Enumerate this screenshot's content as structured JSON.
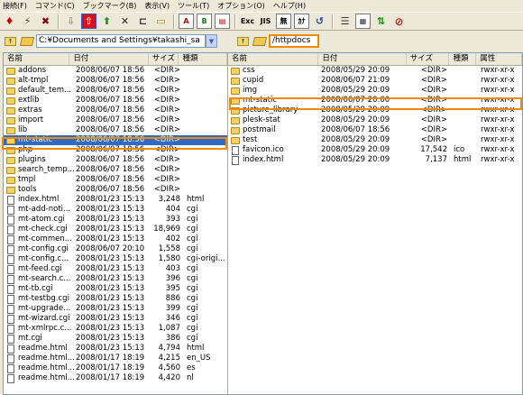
{
  "menu": [
    "接続(F)",
    "コマンド(C)",
    "ブックマーク(B)",
    "表示(V)",
    "ツール(T)",
    "オプション(O)",
    "ヘルプ(H)"
  ],
  "toolbar": {
    "letter_a": "A",
    "letter_b": "B",
    "exc": "Exc",
    "jis": "JIS",
    "mu": "無",
    "kana": "ｶﾅ"
  },
  "left": {
    "path": "C:¥Documents and Settings¥takashi_sa",
    "columns": [
      "名前",
      "日付",
      "サイズ",
      "種類"
    ],
    "rows": [
      {
        "name": "addons",
        "date": "2008/06/07 18:56",
        "size": "<DIR>",
        "type": "",
        "kind": "folder"
      },
      {
        "name": "alt-tmpl",
        "date": "2008/06/07 18:56",
        "size": "<DIR>",
        "type": "",
        "kind": "folder"
      },
      {
        "name": "default_tem...",
        "date": "2008/06/07 18:56",
        "size": "<DIR>",
        "type": "",
        "kind": "folder"
      },
      {
        "name": "extlib",
        "date": "2008/06/07 18:56",
        "size": "<DIR>",
        "type": "",
        "kind": "folder"
      },
      {
        "name": "extras",
        "date": "2008/06/07 18:56",
        "size": "<DIR>",
        "type": "",
        "kind": "folder"
      },
      {
        "name": "import",
        "date": "2008/06/07 18:56",
        "size": "<DIR>",
        "type": "",
        "kind": "folder"
      },
      {
        "name": "lib",
        "date": "2008/06/07 18:56",
        "size": "<DIR>",
        "type": "",
        "kind": "folder"
      },
      {
        "name": "mt-static",
        "date": "2008/06/07 18:56",
        "size": "<DIR>",
        "type": "",
        "kind": "folder",
        "selected": true
      },
      {
        "name": "php",
        "date": "2008/06/07 18:56",
        "size": "<DIR>",
        "type": "",
        "kind": "folder"
      },
      {
        "name": "plugins",
        "date": "2008/06/07 18:56",
        "size": "<DIR>",
        "type": "",
        "kind": "folder"
      },
      {
        "name": "search_temp...",
        "date": "2008/06/07 18:56",
        "size": "<DIR>",
        "type": "",
        "kind": "folder"
      },
      {
        "name": "tmpl",
        "date": "2008/06/07 18:56",
        "size": "<DIR>",
        "type": "",
        "kind": "folder"
      },
      {
        "name": "tools",
        "date": "2008/06/07 18:56",
        "size": "<DIR>",
        "type": "",
        "kind": "folder"
      },
      {
        "name": "index.html",
        "date": "2008/01/23 15:13",
        "size": "3,248",
        "type": "html",
        "kind": "file"
      },
      {
        "name": "mt-add-noti...",
        "date": "2008/01/23 15:13",
        "size": "404",
        "type": "cgi",
        "kind": "file"
      },
      {
        "name": "mt-atom.cgi",
        "date": "2008/01/23 15:13",
        "size": "393",
        "type": "cgi",
        "kind": "file"
      },
      {
        "name": "mt-check.cgi",
        "date": "2008/01/23 15:13",
        "size": "18,969",
        "type": "cgi",
        "kind": "file"
      },
      {
        "name": "mt-commen...",
        "date": "2008/01/23 15:13",
        "size": "402",
        "type": "cgi",
        "kind": "file"
      },
      {
        "name": "mt-config.cgi",
        "date": "2008/06/07 20:10",
        "size": "1,558",
        "type": "cgi",
        "kind": "file"
      },
      {
        "name": "mt-config.c...",
        "date": "2008/01/23 15:13",
        "size": "1,580",
        "type": "cgi-origi...",
        "kind": "file"
      },
      {
        "name": "mt-feed.cgi",
        "date": "2008/01/23 15:13",
        "size": "403",
        "type": "cgi",
        "kind": "file"
      },
      {
        "name": "mt-search.c...",
        "date": "2008/01/23 15:13",
        "size": "396",
        "type": "cgi",
        "kind": "file"
      },
      {
        "name": "mt-tb.cgi",
        "date": "2008/01/23 15:13",
        "size": "395",
        "type": "cgi",
        "kind": "file"
      },
      {
        "name": "mt-testbg.cgi",
        "date": "2008/01/23 15:13",
        "size": "886",
        "type": "cgi",
        "kind": "file"
      },
      {
        "name": "mt-upgrade...",
        "date": "2008/01/23 15:13",
        "size": "399",
        "type": "cgi",
        "kind": "file"
      },
      {
        "name": "mt-wizard.cgi",
        "date": "2008/01/23 15:13",
        "size": "346",
        "type": "cgi",
        "kind": "file"
      },
      {
        "name": "mt-xmlrpc.c...",
        "date": "2008/01/23 15:13",
        "size": "1,087",
        "type": "cgi",
        "kind": "file"
      },
      {
        "name": "mt.cgi",
        "date": "2008/01/23 15:13",
        "size": "386",
        "type": "cgi",
        "kind": "file"
      },
      {
        "name": "readme.html",
        "date": "2008/01/23 15:13",
        "size": "4,794",
        "type": "html",
        "kind": "file"
      },
      {
        "name": "readme.html...",
        "date": "2008/01/17 18:19",
        "size": "4,215",
        "type": "en_US",
        "kind": "file"
      },
      {
        "name": "readme.html...",
        "date": "2008/01/17 18:19",
        "size": "4,560",
        "type": "es",
        "kind": "file"
      },
      {
        "name": "readme.html...",
        "date": "2008/01/17 18:19",
        "size": "4,420",
        "type": "nl",
        "kind": "file"
      }
    ]
  },
  "right": {
    "path": "/httpdocs",
    "columns": [
      "名前",
      "日付",
      "サイズ",
      "種類",
      "属性"
    ],
    "rows": [
      {
        "name": "css",
        "date": "2008/05/29 20:09",
        "size": "<DIR>",
        "type": "",
        "attr": "rwxr-xr-x",
        "kind": "folder"
      },
      {
        "name": "cupid",
        "date": "2008/06/07 21:09",
        "size": "<DIR>",
        "type": "",
        "attr": "rwxr-xr-x",
        "kind": "folder"
      },
      {
        "name": "img",
        "date": "2008/05/29 20:09",
        "size": "<DIR>",
        "type": "",
        "attr": "rwxr-xr-x",
        "kind": "folder"
      },
      {
        "name": "mt-static",
        "date": "2008/06/07 20:00",
        "size": "<DIR>",
        "type": "",
        "attr": "rwxr-xr-x",
        "kind": "folder",
        "highlight": true
      },
      {
        "name": "picture_library",
        "date": "2008/05/29 20:09",
        "size": "<DIR>",
        "type": "",
        "attr": "rwxr-xr-x",
        "kind": "folder"
      },
      {
        "name": "plesk-stat",
        "date": "2008/05/29 20:09",
        "size": "<DIR>",
        "type": "",
        "attr": "rwxr-xr-x",
        "kind": "folder"
      },
      {
        "name": "postmail",
        "date": "2008/06/07 18:56",
        "size": "<DIR>",
        "type": "",
        "attr": "rwxr-xr-x",
        "kind": "folder"
      },
      {
        "name": "test",
        "date": "2008/05/29 20:09",
        "size": "<DIR>",
        "type": "",
        "attr": "rwxr-xr-x",
        "kind": "folder"
      },
      {
        "name": "favicon.ico",
        "date": "2008/05/29 20:09",
        "size": "17,542",
        "type": "ico",
        "attr": "rwxr-xr-x",
        "kind": "file"
      },
      {
        "name": "index.html",
        "date": "2008/05/29 20:09",
        "size": "7,137",
        "type": "html",
        "attr": "rwxr-xr-x",
        "kind": "file"
      }
    ]
  }
}
